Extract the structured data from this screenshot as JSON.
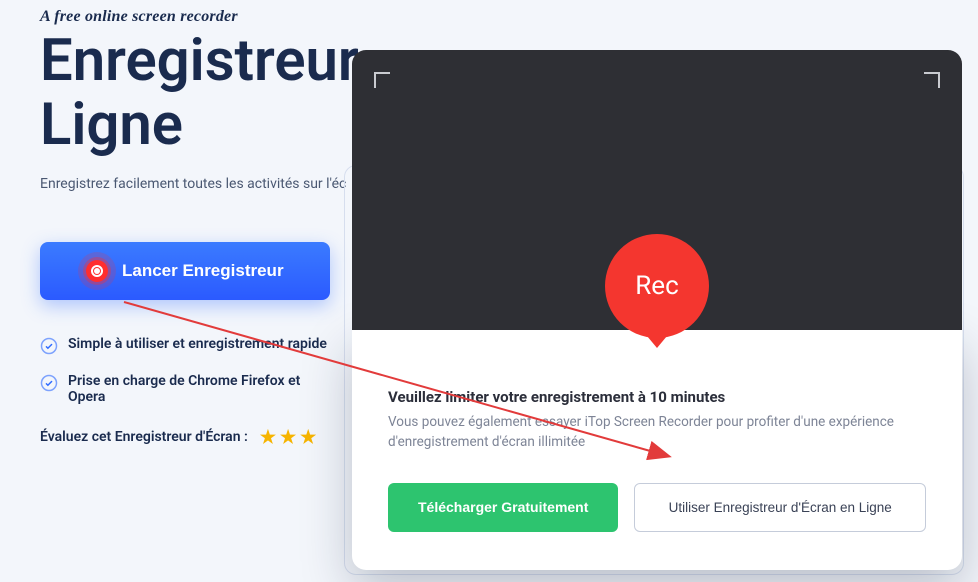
{
  "hero": {
    "tagline": "A free online screen recorder",
    "title_line1": "Enregistreur",
    "title_line2": "Ligne",
    "subtitle": "Enregistrez facilement toutes les activités sur l'éc",
    "launch_label": "Lancer Enregistreur"
  },
  "features": {
    "item1": "Simple à utiliser et enregistrement rapide",
    "item2": "Prise en charge de Chrome Firefox et Opera"
  },
  "rating": {
    "label": "Évaluez cet Enregistreur d'Écran :"
  },
  "rec_button": {
    "label": "Rec"
  },
  "popup": {
    "title": "Veuillez limiter votre enregistrement à 10 minutes",
    "desc": "Vous pouvez également essayer iTop Screen Recorder pour profiter d'une expérience d'enregistrement d'écran illimitée",
    "download_label": "Télécharger Gratuitement",
    "use_label": "Utiliser Enregistreur d'Écran en Ligne"
  }
}
